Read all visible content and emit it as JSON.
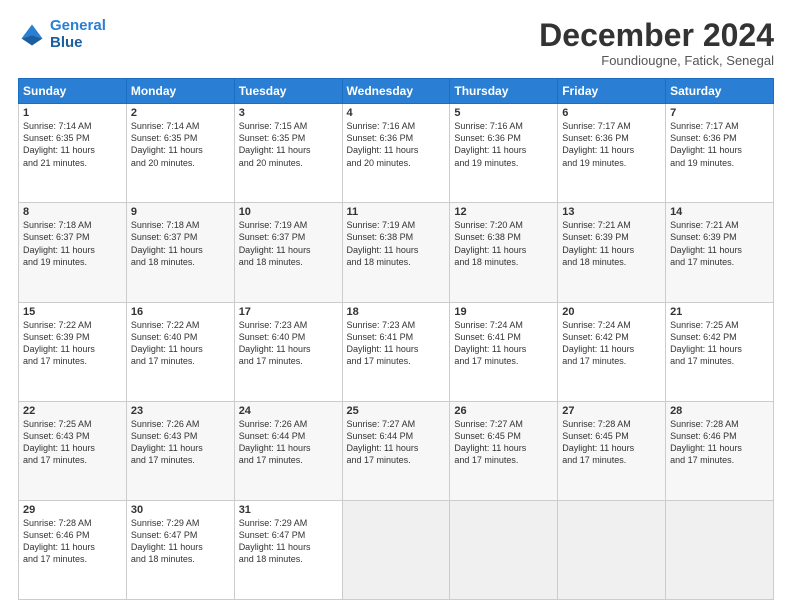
{
  "header": {
    "logo_line1": "General",
    "logo_line2": "Blue",
    "title": "December 2024",
    "subtitle": "Foundiougne, Fatick, Senegal"
  },
  "weekdays": [
    "Sunday",
    "Monday",
    "Tuesday",
    "Wednesday",
    "Thursday",
    "Friday",
    "Saturday"
  ],
  "weeks": [
    [
      {
        "day": "1",
        "lines": [
          "Sunrise: 7:14 AM",
          "Sunset: 6:35 PM",
          "Daylight: 11 hours",
          "and 21 minutes."
        ]
      },
      {
        "day": "2",
        "lines": [
          "Sunrise: 7:14 AM",
          "Sunset: 6:35 PM",
          "Daylight: 11 hours",
          "and 20 minutes."
        ]
      },
      {
        "day": "3",
        "lines": [
          "Sunrise: 7:15 AM",
          "Sunset: 6:35 PM",
          "Daylight: 11 hours",
          "and 20 minutes."
        ]
      },
      {
        "day": "4",
        "lines": [
          "Sunrise: 7:16 AM",
          "Sunset: 6:36 PM",
          "Daylight: 11 hours",
          "and 20 minutes."
        ]
      },
      {
        "day": "5",
        "lines": [
          "Sunrise: 7:16 AM",
          "Sunset: 6:36 PM",
          "Daylight: 11 hours",
          "and 19 minutes."
        ]
      },
      {
        "day": "6",
        "lines": [
          "Sunrise: 7:17 AM",
          "Sunset: 6:36 PM",
          "Daylight: 11 hours",
          "and 19 minutes."
        ]
      },
      {
        "day": "7",
        "lines": [
          "Sunrise: 7:17 AM",
          "Sunset: 6:36 PM",
          "Daylight: 11 hours",
          "and 19 minutes."
        ]
      }
    ],
    [
      {
        "day": "8",
        "lines": [
          "Sunrise: 7:18 AM",
          "Sunset: 6:37 PM",
          "Daylight: 11 hours",
          "and 19 minutes."
        ]
      },
      {
        "day": "9",
        "lines": [
          "Sunrise: 7:18 AM",
          "Sunset: 6:37 PM",
          "Daylight: 11 hours",
          "and 18 minutes."
        ]
      },
      {
        "day": "10",
        "lines": [
          "Sunrise: 7:19 AM",
          "Sunset: 6:37 PM",
          "Daylight: 11 hours",
          "and 18 minutes."
        ]
      },
      {
        "day": "11",
        "lines": [
          "Sunrise: 7:19 AM",
          "Sunset: 6:38 PM",
          "Daylight: 11 hours",
          "and 18 minutes."
        ]
      },
      {
        "day": "12",
        "lines": [
          "Sunrise: 7:20 AM",
          "Sunset: 6:38 PM",
          "Daylight: 11 hours",
          "and 18 minutes."
        ]
      },
      {
        "day": "13",
        "lines": [
          "Sunrise: 7:21 AM",
          "Sunset: 6:39 PM",
          "Daylight: 11 hours",
          "and 18 minutes."
        ]
      },
      {
        "day": "14",
        "lines": [
          "Sunrise: 7:21 AM",
          "Sunset: 6:39 PM",
          "Daylight: 11 hours",
          "and 17 minutes."
        ]
      }
    ],
    [
      {
        "day": "15",
        "lines": [
          "Sunrise: 7:22 AM",
          "Sunset: 6:39 PM",
          "Daylight: 11 hours",
          "and 17 minutes."
        ]
      },
      {
        "day": "16",
        "lines": [
          "Sunrise: 7:22 AM",
          "Sunset: 6:40 PM",
          "Daylight: 11 hours",
          "and 17 minutes."
        ]
      },
      {
        "day": "17",
        "lines": [
          "Sunrise: 7:23 AM",
          "Sunset: 6:40 PM",
          "Daylight: 11 hours",
          "and 17 minutes."
        ]
      },
      {
        "day": "18",
        "lines": [
          "Sunrise: 7:23 AM",
          "Sunset: 6:41 PM",
          "Daylight: 11 hours",
          "and 17 minutes."
        ]
      },
      {
        "day": "19",
        "lines": [
          "Sunrise: 7:24 AM",
          "Sunset: 6:41 PM",
          "Daylight: 11 hours",
          "and 17 minutes."
        ]
      },
      {
        "day": "20",
        "lines": [
          "Sunrise: 7:24 AM",
          "Sunset: 6:42 PM",
          "Daylight: 11 hours",
          "and 17 minutes."
        ]
      },
      {
        "day": "21",
        "lines": [
          "Sunrise: 7:25 AM",
          "Sunset: 6:42 PM",
          "Daylight: 11 hours",
          "and 17 minutes."
        ]
      }
    ],
    [
      {
        "day": "22",
        "lines": [
          "Sunrise: 7:25 AM",
          "Sunset: 6:43 PM",
          "Daylight: 11 hours",
          "and 17 minutes."
        ]
      },
      {
        "day": "23",
        "lines": [
          "Sunrise: 7:26 AM",
          "Sunset: 6:43 PM",
          "Daylight: 11 hours",
          "and 17 minutes."
        ]
      },
      {
        "day": "24",
        "lines": [
          "Sunrise: 7:26 AM",
          "Sunset: 6:44 PM",
          "Daylight: 11 hours",
          "and 17 minutes."
        ]
      },
      {
        "day": "25",
        "lines": [
          "Sunrise: 7:27 AM",
          "Sunset: 6:44 PM",
          "Daylight: 11 hours",
          "and 17 minutes."
        ]
      },
      {
        "day": "26",
        "lines": [
          "Sunrise: 7:27 AM",
          "Sunset: 6:45 PM",
          "Daylight: 11 hours",
          "and 17 minutes."
        ]
      },
      {
        "day": "27",
        "lines": [
          "Sunrise: 7:28 AM",
          "Sunset: 6:45 PM",
          "Daylight: 11 hours",
          "and 17 minutes."
        ]
      },
      {
        "day": "28",
        "lines": [
          "Sunrise: 7:28 AM",
          "Sunset: 6:46 PM",
          "Daylight: 11 hours",
          "and 17 minutes."
        ]
      }
    ],
    [
      {
        "day": "29",
        "lines": [
          "Sunrise: 7:28 AM",
          "Sunset: 6:46 PM",
          "Daylight: 11 hours",
          "and 17 minutes."
        ]
      },
      {
        "day": "30",
        "lines": [
          "Sunrise: 7:29 AM",
          "Sunset: 6:47 PM",
          "Daylight: 11 hours",
          "and 18 minutes."
        ]
      },
      {
        "day": "31",
        "lines": [
          "Sunrise: 7:29 AM",
          "Sunset: 6:47 PM",
          "Daylight: 11 hours",
          "and 18 minutes."
        ]
      },
      {
        "day": "",
        "lines": []
      },
      {
        "day": "",
        "lines": []
      },
      {
        "day": "",
        "lines": []
      },
      {
        "day": "",
        "lines": []
      }
    ]
  ]
}
